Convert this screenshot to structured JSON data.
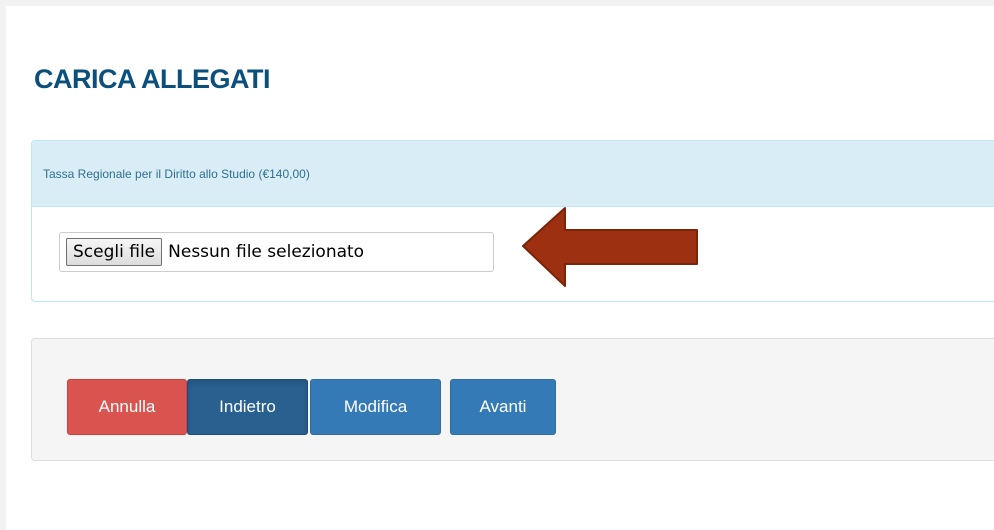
{
  "page": {
    "title": "CARICA ALLEGATI"
  },
  "upload_panel": {
    "heading": "Tassa Regionale per il Diritto allo Studio (€140,00)",
    "file_button_label": "Scegli file",
    "file_status": "Nessun file selezionato"
  },
  "annotation": {
    "arrow_color": "#9c3010",
    "icon": "left-arrow-icon"
  },
  "actions": {
    "cancel_label": "Annulla",
    "back_label": "Indietro",
    "edit_label": "Modifica",
    "next_label": "Avanti"
  },
  "colors": {
    "title": "#0b4f7c",
    "danger": "#d9534f",
    "primary": "#337ab7",
    "panel_heading_bg": "#d9edf7"
  }
}
